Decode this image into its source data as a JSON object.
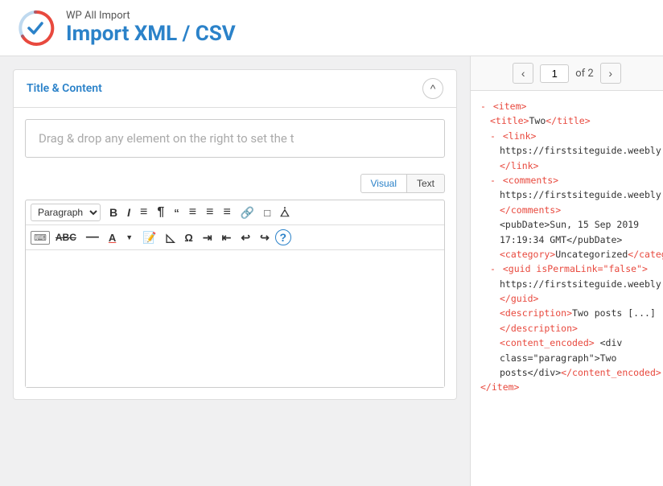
{
  "header": {
    "subtitle": "WP All Import",
    "title": "Import XML / CSV",
    "logo_alt": "WP All Import Logo"
  },
  "section": {
    "title": "Title & Content",
    "collapse_label": "^"
  },
  "drag_drop": {
    "placeholder": "Drag & drop any element on the right to set the t"
  },
  "editor_tabs": [
    {
      "label": "Visual",
      "active": true
    },
    {
      "label": "Text",
      "active": false
    }
  ],
  "toolbar": {
    "paragraph_options": [
      "Paragraph"
    ],
    "paragraph_selected": "Paragraph",
    "buttons_row1": [
      "B",
      "I",
      "≡",
      "¶",
      "❝",
      "≡",
      "≡",
      "≡",
      "🔗",
      "□",
      "⤢"
    ],
    "buttons_row2": [
      "ABС",
      "—",
      "A",
      "▼",
      "🏛",
      "◇",
      "Ω",
      "≣",
      "≣",
      "↩",
      "↪",
      "?"
    ]
  },
  "xml_nav": {
    "prev_label": "‹",
    "next_label": "›",
    "current_page": "1",
    "total_label": "of 2"
  },
  "xml_content": {
    "lines": [
      {
        "indent": 0,
        "bullet": true,
        "content": "<item>",
        "type": "tag"
      },
      {
        "indent": 1,
        "bullet": false,
        "content": "<title>Two</title>",
        "type": "mixed"
      },
      {
        "indent": 1,
        "bullet": true,
        "content": "<link>",
        "type": "tag"
      },
      {
        "indent": 2,
        "bullet": false,
        "content": "https://firstsiteguide.weebly.com/r",
        "type": "text"
      },
      {
        "indent": 1,
        "bullet": false,
        "content": "</link>",
        "type": "tag"
      },
      {
        "indent": 1,
        "bullet": true,
        "content": "<comments>",
        "type": "tag"
      },
      {
        "indent": 2,
        "bullet": false,
        "content": "https://firstsiteguide.weebly.com/r",
        "type": "text"
      },
      {
        "indent": 1,
        "bullet": false,
        "content": "</comments>",
        "type": "tag"
      },
      {
        "indent": 2,
        "bullet": false,
        "content": "<pubDate>Sun, 15 Sep 2019",
        "type": "mixed"
      },
      {
        "indent": 2,
        "bullet": false,
        "content": "17:19:34 GMT</pubDate>",
        "type": "mixed"
      },
      {
        "indent": 2,
        "bullet": false,
        "content": "<category>Uncategorized</catego",
        "type": "mixed"
      },
      {
        "indent": 1,
        "bullet": true,
        "content": "<guid isPermaLink=\"false\">",
        "type": "tag"
      },
      {
        "indent": 2,
        "bullet": false,
        "content": "https://firstsiteguide.weebly.com/r",
        "type": "text"
      },
      {
        "indent": 1,
        "bullet": false,
        "content": "</guid>",
        "type": "tag"
      },
      {
        "indent": 2,
        "bullet": false,
        "content": "<description>Two posts [...]",
        "type": "mixed"
      },
      {
        "indent": 2,
        "bullet": false,
        "content": "</description>",
        "type": "tag"
      },
      {
        "indent": 2,
        "bullet": false,
        "content": "<content_encoded> <div",
        "type": "mixed"
      },
      {
        "indent": 2,
        "bullet": false,
        "content": "class=\"paragraph\">Two",
        "type": "text"
      },
      {
        "indent": 2,
        "bullet": false,
        "content": "posts</div></content_encoded>",
        "type": "mixed"
      },
      {
        "indent": 0,
        "bullet": false,
        "content": "</item>",
        "type": "tag"
      }
    ]
  }
}
